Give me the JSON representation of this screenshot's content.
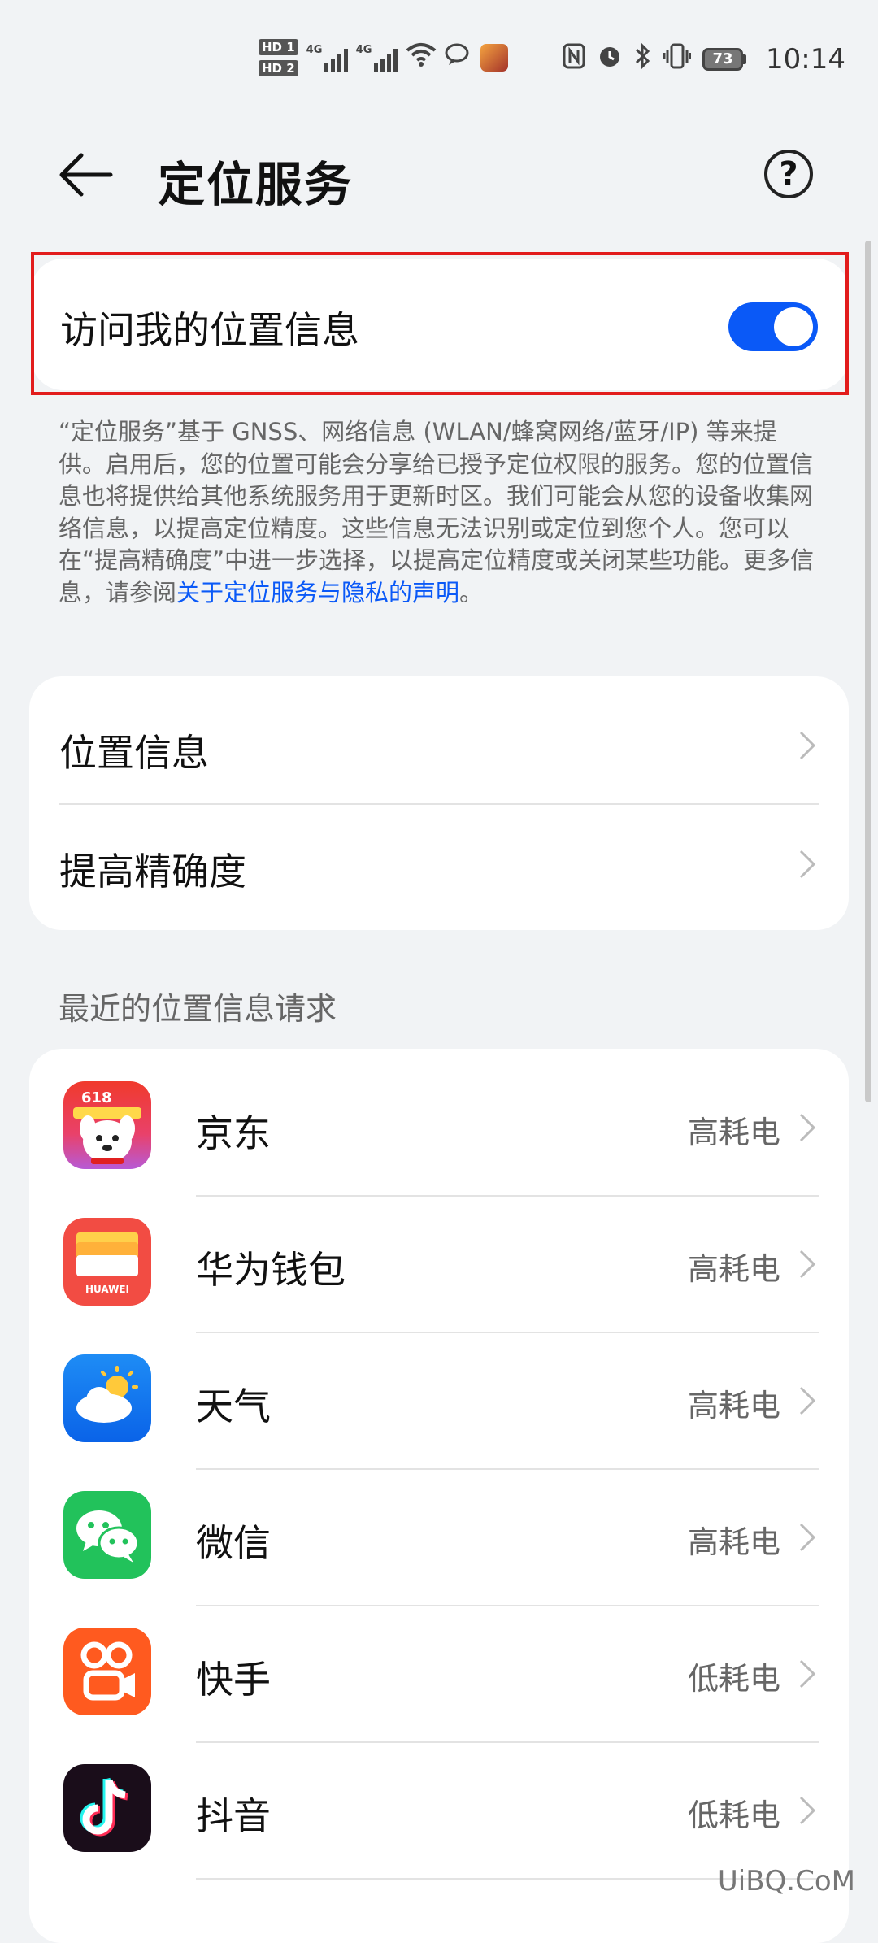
{
  "status_bar": {
    "hd1": "HD 1",
    "hd2": "HD 2",
    "net1": "4G",
    "net2": "4G",
    "battery": "73",
    "time": "10:14"
  },
  "header": {
    "title": "定位服务"
  },
  "location_toggle": {
    "label": "访问我的位置信息",
    "enabled": true
  },
  "description": {
    "text": "“定位服务”基于 GNSS、网络信息 (WLAN/蜂窝网络/蓝牙/IP) 等来提供。启用后，您的位置可能会分享给已授予定位权限的服务。您的位置信息也将提供给其他系统服务用于更新时区。我们可能会从您的设备收集网络信息，以提高定位精度。这些信息无法识别或定位到您个人。您可以在“提高精确度”中进一步选择，以提高定位精度或关闭某些功能。更多信息，请参阅",
    "link": "关于定位服务与隐私的声明",
    "suffix": "。"
  },
  "settings": {
    "items": [
      {
        "label": "位置信息"
      },
      {
        "label": "提高精确度"
      }
    ]
  },
  "recent": {
    "title": "最近的位置信息请求",
    "apps": [
      {
        "name": "京东",
        "power": "高耗电",
        "icon": "jd-icon",
        "badge": "618"
      },
      {
        "name": "华为钱包",
        "power": "高耗电",
        "icon": "huawei-wallet-icon",
        "brand": "HUAWEI"
      },
      {
        "name": "天气",
        "power": "高耗电",
        "icon": "weather-icon"
      },
      {
        "name": "微信",
        "power": "高耗电",
        "icon": "wechat-icon"
      },
      {
        "name": "快手",
        "power": "低耗电",
        "icon": "kuaishou-icon"
      },
      {
        "name": "抖音",
        "power": "低耗电",
        "icon": "douyin-icon"
      }
    ]
  },
  "watermark": "UiBQ.CoM",
  "colors": {
    "accent": "#0a59f7",
    "highlight": "#e21c1c",
    "background": "#f1f3f5"
  }
}
